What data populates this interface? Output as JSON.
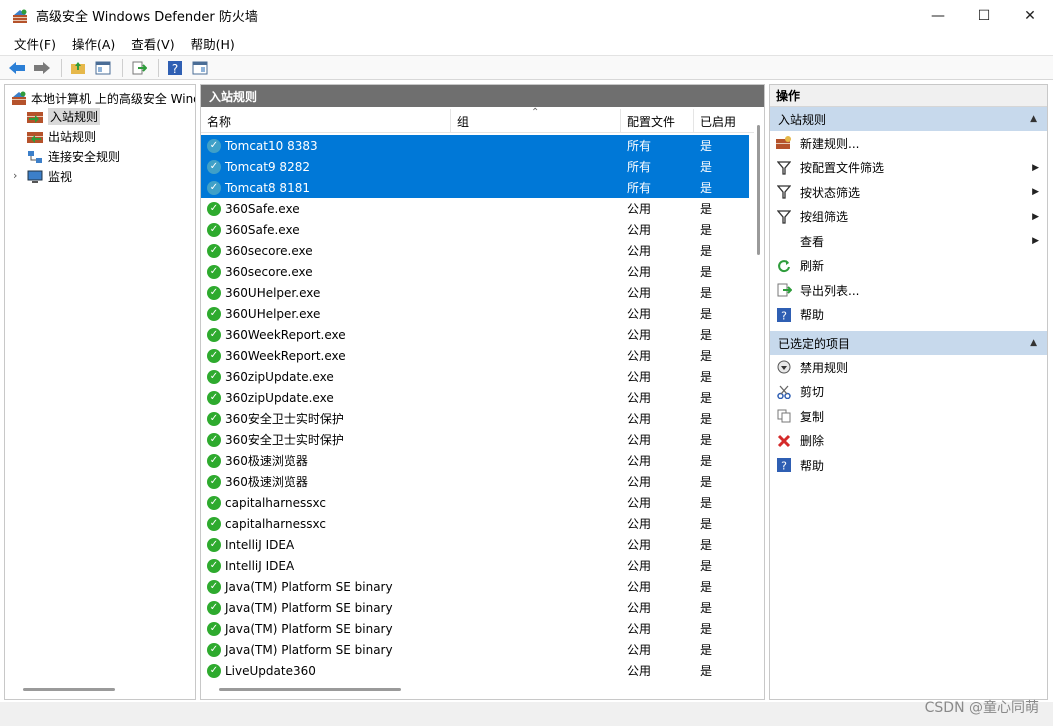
{
  "window": {
    "title": "高级安全 Windows Defender 防火墙",
    "minimize": "—",
    "maximize": "☐",
    "close": "✕"
  },
  "menu": [
    "文件(F)",
    "操作(A)",
    "查看(V)",
    "帮助(H)"
  ],
  "tree": {
    "root": "本地计算机 上的高级安全 Windows",
    "items": [
      {
        "label": "入站规则",
        "selected": true
      },
      {
        "label": "出站规则",
        "selected": false
      },
      {
        "label": "连接安全规则",
        "selected": false
      },
      {
        "label": "监视",
        "selected": false,
        "expandable": true
      }
    ]
  },
  "center": {
    "header": "入站规则",
    "columns": {
      "name": "名称",
      "group": "组",
      "profile": "配置文件",
      "enabled": "已启用"
    },
    "rows": [
      {
        "name": "Tomcat10 8383",
        "profile": "所有",
        "enabled": "是",
        "selected": true
      },
      {
        "name": "Tomcat9 8282",
        "profile": "所有",
        "enabled": "是",
        "selected": true
      },
      {
        "name": "Tomcat8 8181",
        "profile": "所有",
        "enabled": "是",
        "selected": true
      },
      {
        "name": "360Safe.exe",
        "profile": "公用",
        "enabled": "是"
      },
      {
        "name": "360Safe.exe",
        "profile": "公用",
        "enabled": "是"
      },
      {
        "name": "360secore.exe",
        "profile": "公用",
        "enabled": "是"
      },
      {
        "name": "360secore.exe",
        "profile": "公用",
        "enabled": "是"
      },
      {
        "name": "360UHelper.exe",
        "profile": "公用",
        "enabled": "是"
      },
      {
        "name": "360UHelper.exe",
        "profile": "公用",
        "enabled": "是"
      },
      {
        "name": "360WeekReport.exe",
        "profile": "公用",
        "enabled": "是"
      },
      {
        "name": "360WeekReport.exe",
        "profile": "公用",
        "enabled": "是"
      },
      {
        "name": "360zipUpdate.exe",
        "profile": "公用",
        "enabled": "是"
      },
      {
        "name": "360zipUpdate.exe",
        "profile": "公用",
        "enabled": "是"
      },
      {
        "name": "360安全卫士实时保护",
        "profile": "公用",
        "enabled": "是"
      },
      {
        "name": "360安全卫士实时保护",
        "profile": "公用",
        "enabled": "是"
      },
      {
        "name": "360极速浏览器",
        "profile": "公用",
        "enabled": "是"
      },
      {
        "name": "360极速浏览器",
        "profile": "公用",
        "enabled": "是"
      },
      {
        "name": "capitalharnessxc",
        "profile": "公用",
        "enabled": "是"
      },
      {
        "name": "capitalharnessxc",
        "profile": "公用",
        "enabled": "是"
      },
      {
        "name": "IntelliJ IDEA",
        "profile": "公用",
        "enabled": "是"
      },
      {
        "name": "IntelliJ IDEA",
        "profile": "公用",
        "enabled": "是"
      },
      {
        "name": "Java(TM) Platform SE binary",
        "profile": "公用",
        "enabled": "是"
      },
      {
        "name": "Java(TM) Platform SE binary",
        "profile": "公用",
        "enabled": "是"
      },
      {
        "name": "Java(TM) Platform SE binary",
        "profile": "公用",
        "enabled": "是"
      },
      {
        "name": "Java(TM) Platform SE binary",
        "profile": "公用",
        "enabled": "是"
      },
      {
        "name": "LiveUpdate360",
        "profile": "公用",
        "enabled": "是"
      }
    ]
  },
  "actions": {
    "header": "操作",
    "section1": {
      "title": "入站规则",
      "items": [
        {
          "label": "新建规则...",
          "icon": "new-rule-icon",
          "submenu": false
        },
        {
          "label": "按配置文件筛选",
          "icon": "filter-icon",
          "submenu": true
        },
        {
          "label": "按状态筛选",
          "icon": "filter-icon",
          "submenu": true
        },
        {
          "label": "按组筛选",
          "icon": "filter-icon",
          "submenu": true
        },
        {
          "label": "查看",
          "icon": "",
          "submenu": true
        },
        {
          "label": "刷新",
          "icon": "refresh-icon",
          "submenu": false
        },
        {
          "label": "导出列表...",
          "icon": "export-icon",
          "submenu": false
        },
        {
          "label": "帮助",
          "icon": "help-icon",
          "submenu": false
        }
      ]
    },
    "section2": {
      "title": "已选定的项目",
      "items": [
        {
          "label": "禁用规则",
          "icon": "disable-icon"
        },
        {
          "label": "剪切",
          "icon": "cut-icon"
        },
        {
          "label": "复制",
          "icon": "copy-icon"
        },
        {
          "label": "删除",
          "icon": "delete-icon"
        },
        {
          "label": "帮助",
          "icon": "help-icon"
        }
      ]
    }
  },
  "watermark": "CSDN @童心同萌",
  "colors": {
    "selection": "#0078d7",
    "section_bg": "#c7d9ec",
    "pane_header": "#6f6f6f"
  }
}
